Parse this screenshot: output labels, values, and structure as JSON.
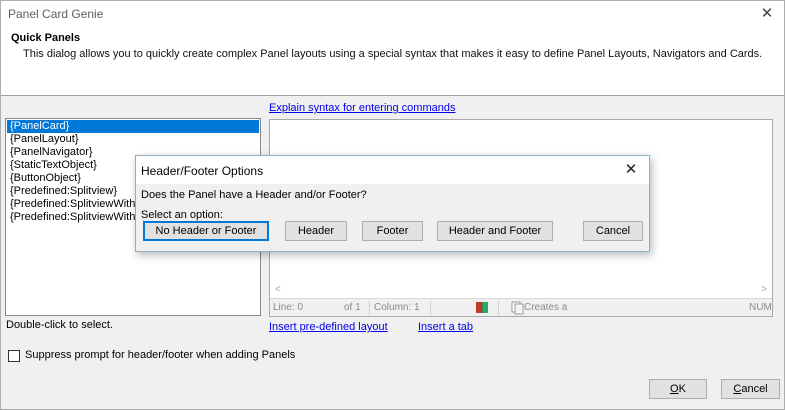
{
  "window": {
    "title": "Panel Card Genie",
    "close_glyph": "✕"
  },
  "header": {
    "title": "Quick Panels",
    "description": "This dialog allows you to quickly create complex Panel layouts using a special syntax that makes it easy to define Panel Layouts, Navigators and Cards."
  },
  "list": {
    "items": [
      "{PanelCard}",
      "{PanelLayout}",
      "{PanelNavigator}",
      "{StaticTextObject}",
      "{ButtonObject}",
      "{Predefined:Splitview}",
      "{Predefined:SplitviewWithHeader}",
      "{Predefined:SplitviewWithHeaderAndFooter}"
    ],
    "selected_index": 0,
    "hint": "Double-click to select."
  },
  "links": {
    "explain_syntax": "Explain syntax for entering commands",
    "insert_layout": "Insert pre-defined layout",
    "insert_tab": "Insert a tab"
  },
  "editor": {
    "scroll_left": "<",
    "scroll_right": ">",
    "status": {
      "line": "Line: 0",
      "of": "of 1",
      "column": "Column: 1",
      "creates": "Creates a",
      "num": "NUM"
    }
  },
  "checkbox": {
    "label": "Suppress prompt for header/footer when adding Panels",
    "checked": false
  },
  "buttons": {
    "ok": "OK",
    "cancel": "Cancel"
  },
  "dialog": {
    "title": "Header/Footer Options",
    "close_glyph": "✕",
    "question": "Does the Panel have a Header and/or Footer?",
    "prompt": "Select an option:",
    "options": {
      "none": "No Header or Footer",
      "header": "Header",
      "footer": "Footer",
      "both": "Header and Footer",
      "cancel": "Cancel"
    }
  },
  "colors": {
    "selection": "#0078d7",
    "link": "#0000ee",
    "book_icon": "#c0392b"
  }
}
